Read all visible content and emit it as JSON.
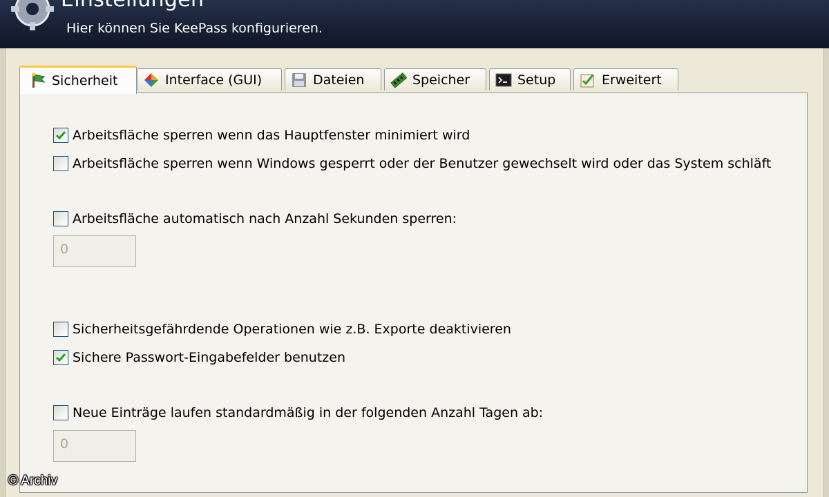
{
  "header": {
    "title": "Einstellungen",
    "subtitle": "Hier können Sie KeePass konfigurieren.",
    "icon": "gears-icon"
  },
  "tabs": [
    {
      "label": "Sicherheit",
      "icon": "security-flag-icon",
      "active": true
    },
    {
      "label": "Interface (GUI)",
      "icon": "interface-icon",
      "active": false
    },
    {
      "label": "Dateien",
      "icon": "floppy-disk-icon",
      "active": false
    },
    {
      "label": "Speicher",
      "icon": "memory-icon",
      "active": false
    },
    {
      "label": "Setup",
      "icon": "console-icon",
      "active": false
    },
    {
      "label": "Erweitert",
      "icon": "advanced-icon",
      "active": false
    }
  ],
  "options": {
    "lock_minimize": {
      "label": "Arbeitsfläche sperren wenn das Hauptfenster minimiert wird",
      "checked": true
    },
    "lock_windows": {
      "label": "Arbeitsfläche sperren wenn Windows gesperrt oder der Benutzer gewechselt wird oder das System schläft",
      "checked": false
    },
    "lock_auto": {
      "label": "Arbeitsfläche automatisch nach Anzahl Sekunden sperren:",
      "checked": false,
      "value": "0"
    },
    "disable_insecure": {
      "label": "Sicherheitsgefährdende Operationen wie z.B. Exporte deaktivieren",
      "checked": false
    },
    "secure_edit": {
      "label": "Sichere Passwort-Eingabefelder benutzen",
      "checked": true
    },
    "expire_default": {
      "label": "Neue Einträge laufen standardmäßig in der folgenden Anzahl Tagen ab:",
      "checked": false,
      "value": "0"
    }
  },
  "watermark": "© Archiv",
  "colors": {
    "accent_tab": "#ffc83c",
    "check": "#21a121",
    "banner": "#1a2338"
  }
}
